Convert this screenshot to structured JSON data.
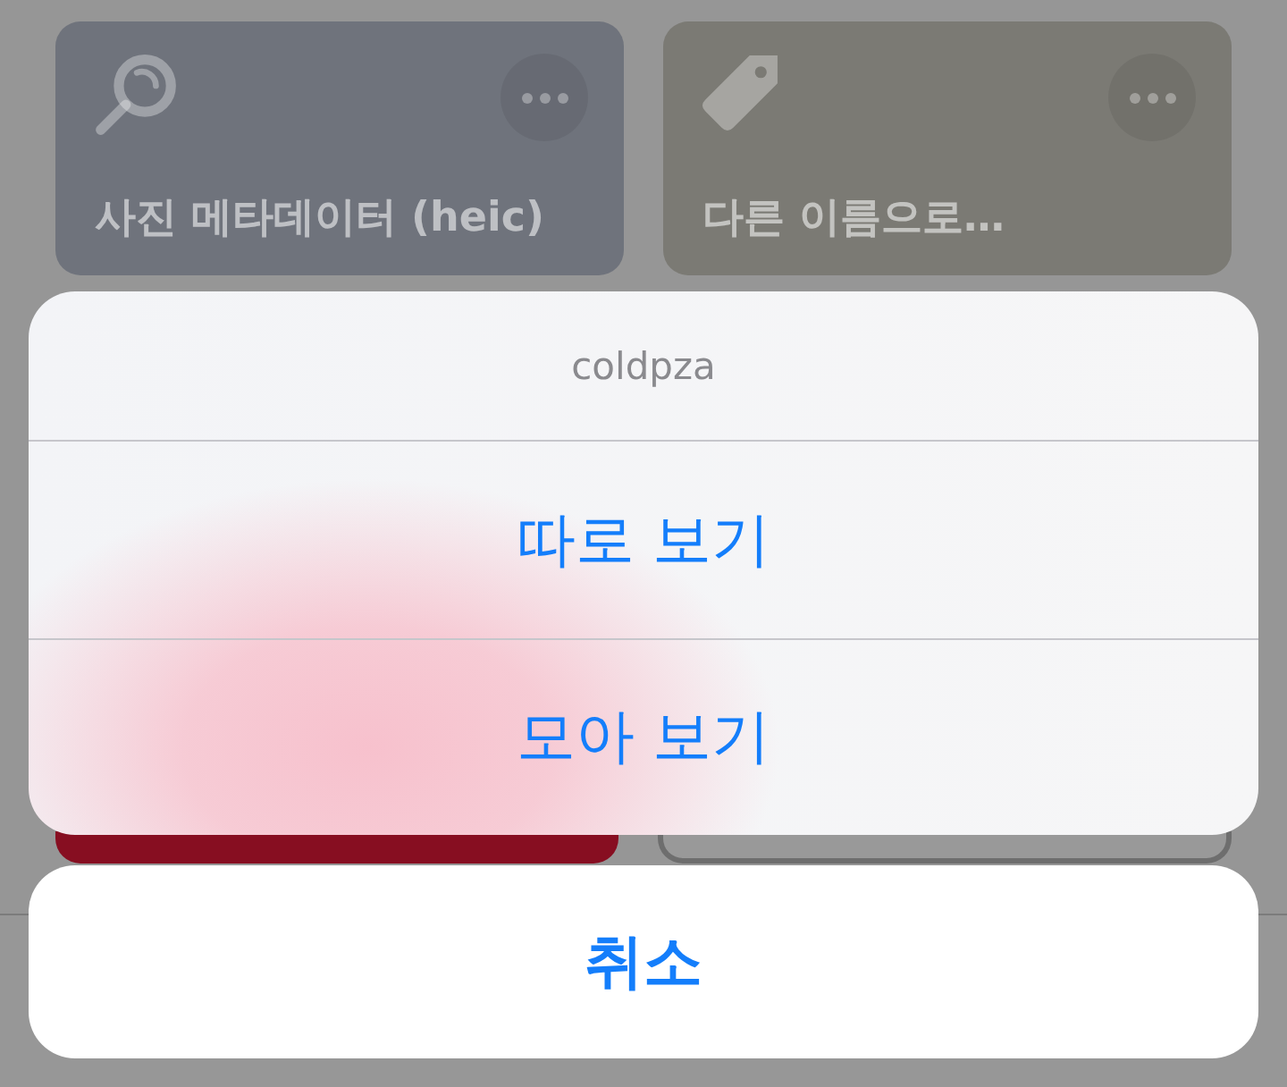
{
  "shortcuts": [
    {
      "title": "사진 메타데이터 (heic)",
      "color": "#6f737c"
    },
    {
      "title": "다른 이름으로…",
      "color": "#7b7a74"
    }
  ],
  "lower_shortcuts": [
    {
      "kind": "filled",
      "color": "#870e21"
    },
    {
      "kind": "outlined",
      "color": "#6e6e6e"
    }
  ],
  "action_sheet": {
    "title": "coldpza",
    "options": [
      "따로 보기",
      "모아 보기"
    ]
  },
  "cancel_button": "취소"
}
